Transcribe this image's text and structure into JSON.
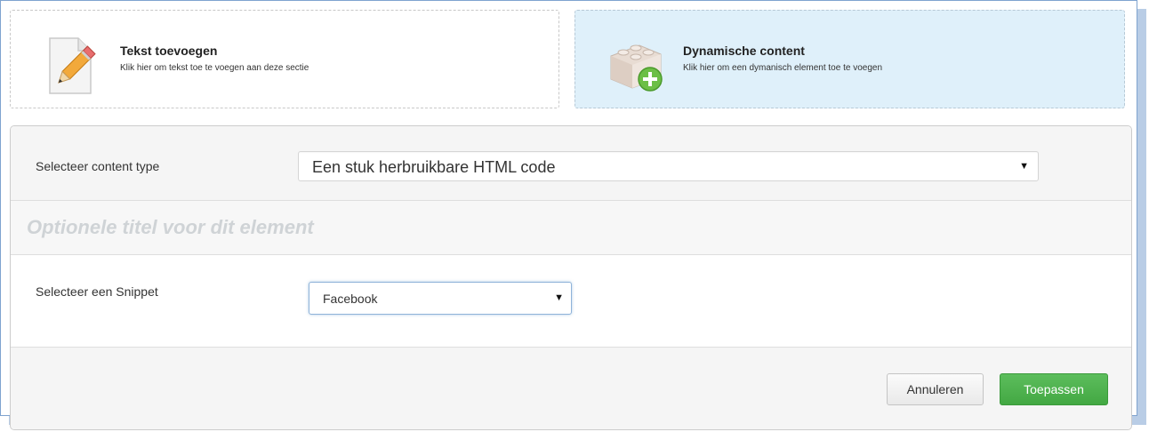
{
  "options": {
    "text": {
      "title": "Tekst toevoegen",
      "description": "Klik hier om tekst toe te voegen aan deze sectie",
      "icon": "pencil-document-icon"
    },
    "dynamic": {
      "title": "Dynamische content",
      "description": "Klik hier om een dymanisch element toe te voegen",
      "icon": "lego-block-add-icon"
    }
  },
  "form": {
    "content_type_label": "Selecteer content type",
    "content_type_value": "Een stuk herbruikbare HTML code",
    "title_placeholder": "Optionele titel voor dit element",
    "snippet_label": "Selecteer een Snippet",
    "snippet_value": "Facebook"
  },
  "buttons": {
    "cancel": "Annuleren",
    "apply": "Toepassen"
  },
  "colors": {
    "selected_option_bg": "#dff0fa",
    "apply_button": "#4cae4c",
    "frame_border": "#7fa3cf"
  }
}
